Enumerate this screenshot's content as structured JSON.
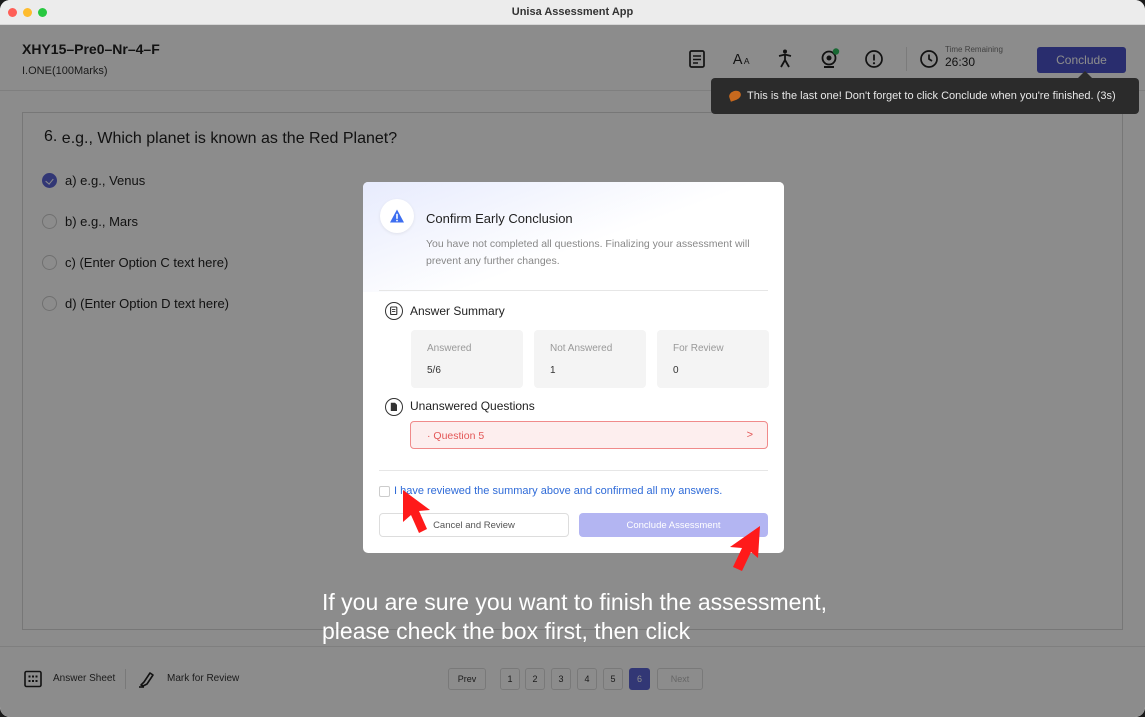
{
  "window": {
    "title": "Unisa Assessment App"
  },
  "header": {
    "exam_code": "XHY15–Pre0–Nr–4–F",
    "marks": "I.ONE(100Marks)",
    "icons": [
      "notes-icon",
      "font-size-icon",
      "accessibility-icon",
      "webcam-icon",
      "alert-icon",
      "clock-icon"
    ],
    "timer_label": "Time Remaining",
    "timer_value": "26:30",
    "conclude_label": "Conclude"
  },
  "tooltip": {
    "text": "This is the last one! Don't forget to click Conclude when you're finished. (3s)"
  },
  "question": {
    "number": "6.",
    "text": "e.g., Which planet is known as the Red Planet?",
    "options": [
      {
        "label": "a) e.g., Venus",
        "checked": true
      },
      {
        "label": "b) e.g., Mars",
        "checked": false
      },
      {
        "label": "c) (Enter Option C text here)",
        "checked": false
      },
      {
        "label": "d) (Enter Option D text here)",
        "checked": false
      }
    ]
  },
  "footer": {
    "answer_sheet_label": "Answer Sheet",
    "mark_review_label": "Mark for Review",
    "prev_label": "Prev",
    "next_label": "Next",
    "pages": [
      "1",
      "2",
      "3",
      "4",
      "5",
      "6"
    ],
    "active_page": "6"
  },
  "modal": {
    "title": "Confirm Early Conclusion",
    "description": "You have not completed all questions. Finalizing your assessment will prevent any further changes.",
    "summary_title": "Answer Summary",
    "stats": [
      {
        "label": "Answered",
        "value": "5/6"
      },
      {
        "label": "Not Answered",
        "value": "1"
      },
      {
        "label": "For Review",
        "value": "0"
      }
    ],
    "unanswered_title": "Unanswered Questions",
    "unanswered_item": "· Question 5",
    "unanswered_chevron": ">",
    "confirm_label": "I have reviewed the summary above and confirmed all my answers.",
    "cancel_label": "Cancel and Review",
    "conclude_label": "Conclude Assessment"
  },
  "instruction": {
    "line1": "If you are sure you want to finish the assessment,",
    "line2": "please check the box first, then click"
  },
  "colors": {
    "accent": "#4b52c9",
    "error": "#e35757",
    "link": "#2f6bd8",
    "arrow": "#ff1a1a"
  }
}
